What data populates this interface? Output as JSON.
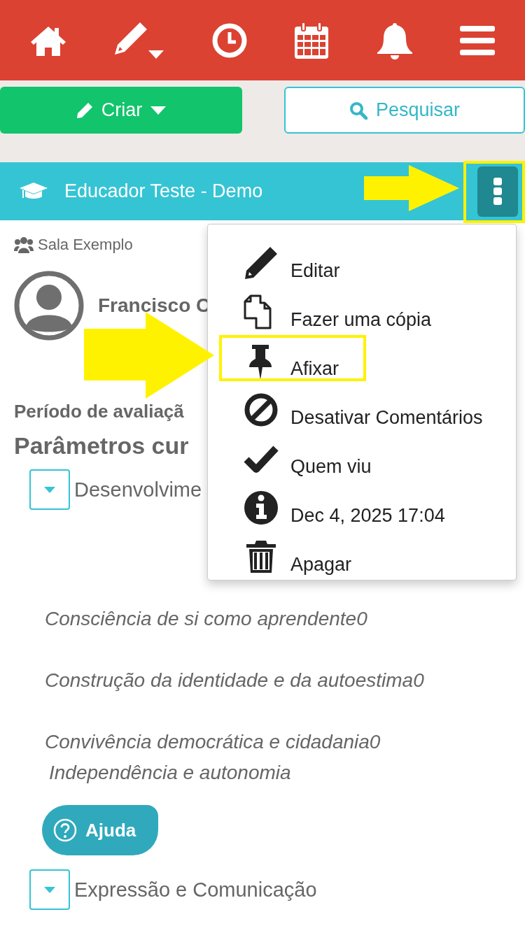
{
  "create_button": {
    "label": "Criar"
  },
  "search_button": {
    "label": "Pesquisar"
  },
  "post": {
    "title": "Educador Teste - Demo",
    "class_name": "Sala Exemplo",
    "student_name": "Francisco C",
    "period_label": "Período de avaliaçã",
    "section_title": "Parâmetros cur",
    "groups": [
      {
        "title": "Desenvolvime",
        "items": [
          {
            "kind": "paragraph",
            "text": "Consciência de si como aprendente0"
          },
          {
            "kind": "paragraph",
            "text": "Construção da identidade e da autoestima0"
          },
          {
            "kind": "paragraph",
            "text": "Convivência democrática e cidadania0"
          },
          {
            "kind": "continuation",
            "text": "Independência e autonomia"
          }
        ],
        "help_button": "Ajuda"
      },
      {
        "title": "Expressão e Comunicação"
      }
    ]
  },
  "menu": {
    "items": [
      {
        "kind": "edit",
        "label": "Editar",
        "highlighted": false
      },
      {
        "kind": "copy",
        "label": "Fazer uma cópia",
        "highlighted": false
      },
      {
        "kind": "pin",
        "label": "Afixar",
        "highlighted": true
      },
      {
        "kind": "block",
        "label": "Desativar Comentários",
        "highlighted": false
      },
      {
        "kind": "check",
        "label": "Quem viu",
        "highlighted": false
      },
      {
        "kind": "info",
        "label": "Dec 4, 2025 17:04",
        "highlighted": false
      },
      {
        "kind": "trash",
        "label": "Apagar",
        "highlighted": false
      }
    ]
  }
}
